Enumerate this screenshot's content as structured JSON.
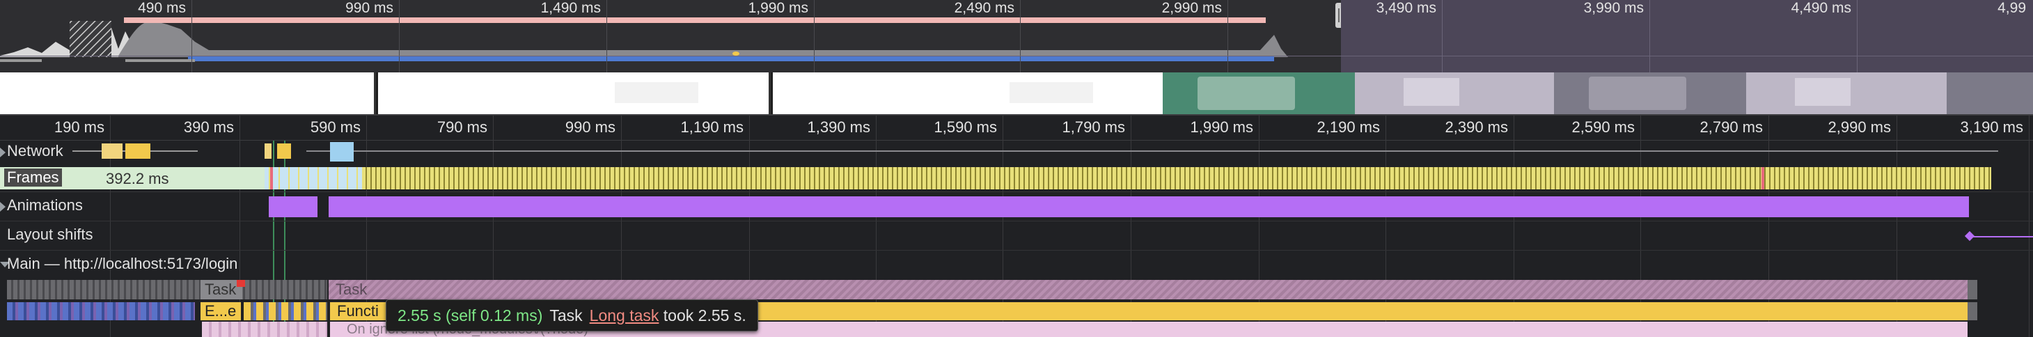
{
  "overview": {
    "ticks": [
      "490 ms",
      "990 ms",
      "1,490 ms",
      "1,990 ms",
      "2,490 ms",
      "2,990 ms",
      "3,490 ms",
      "3,990 ms",
      "4,490 ms",
      "4,99"
    ]
  },
  "ruler": {
    "ticks": [
      "190 ms",
      "390 ms",
      "590 ms",
      "790 ms",
      "990 ms",
      "1,190 ms",
      "1,390 ms",
      "1,590 ms",
      "1,790 ms",
      "1,990 ms",
      "2,190 ms",
      "2,390 ms",
      "2,590 ms",
      "2,790 ms",
      "2,990 ms",
      "3,190 ms"
    ]
  },
  "tracks": {
    "network": "Network",
    "frames": "Frames",
    "frames_duration": "392.2 ms",
    "animations": "Animations",
    "layout_shifts": "Layout shifts",
    "main": "Main — http://localhost:5173/login"
  },
  "flame": {
    "task_left": "Task",
    "task_main": "Task",
    "event_short": "E...e",
    "function_call": "Functi",
    "ignore_list": "On ignore list (/node_modules\\/(?node)"
  },
  "tooltip": {
    "time": "2.55 s (self 0.12 ms)",
    "name": "Task",
    "link": "Long task",
    "rest": "took 2.55 s."
  },
  "colors": {
    "frames_bar": "#e8e07a",
    "animations": "#b56ef5",
    "task": "#8e7a8c",
    "function": "#f2c94c",
    "tooltip_time": "#7ee787",
    "tooltip_link": "#f28b82",
    "selection": "#4c4658"
  }
}
